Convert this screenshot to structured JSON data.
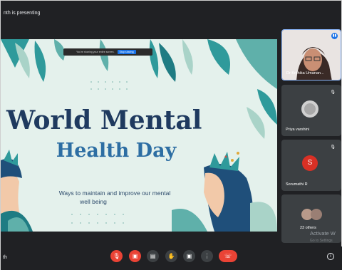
{
  "header": {
    "presenting_text": "nth is presenting"
  },
  "slide": {
    "share_bar_text": "You're sharing your entire screen.",
    "share_stop_label": "Stop sharing",
    "title_line1": "World Mental",
    "title_line2": "Health Day",
    "subtitle_line1": "Ways to maintain and improve our mental",
    "subtitle_line2": "well being"
  },
  "participants": [
    {
      "name": "Dr Krithika Umanan...",
      "muted": false,
      "speaking": true,
      "icon": "speaking-icon"
    },
    {
      "name": "Priya varshini",
      "muted": true,
      "icon": "mic-off-icon"
    },
    {
      "name": "Sorumathi R",
      "initial": "S",
      "muted": true,
      "icon": "mic-off-icon"
    },
    {
      "name": "23 others"
    }
  ],
  "watermark": {
    "line1": "Activate W",
    "line2": "Go to Settings"
  },
  "bottom_bar": {
    "meeting_name": "th",
    "controls": [
      "mic-off-icon",
      "camera-off-icon",
      "captions-icon",
      "raise-hand-icon",
      "present-screen-icon",
      "more-options-icon",
      "leave-call-icon"
    ],
    "info_icon": "info-icon"
  },
  "colors": {
    "background": "#202124",
    "tile": "#3c4043",
    "accent_red": "#ea4335",
    "accent_blue": "#1a73e8",
    "slide_bg": "#e4f1ec",
    "title_dark": "#1f3a5f",
    "title_blue": "#2d6ea3"
  }
}
